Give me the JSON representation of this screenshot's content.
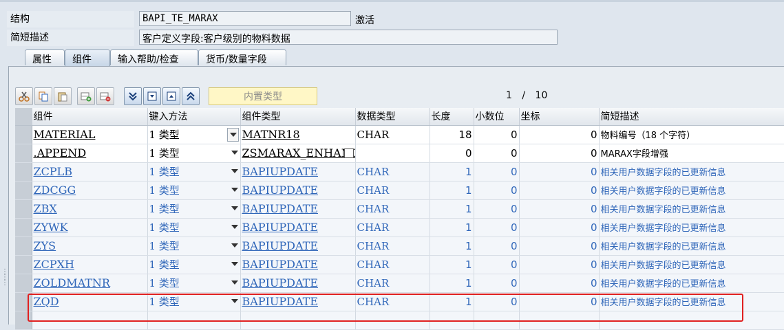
{
  "header": {
    "structure_label": "结构",
    "structure_value": "BAPI_TE_MARAX",
    "status": "激活",
    "desc_label": "简短描述",
    "desc_value": "客户定义字段:客户级别的物料数据"
  },
  "tabs": [
    {
      "label": "属性"
    },
    {
      "label": "组件"
    },
    {
      "label": "输入帮助/检查"
    },
    {
      "label": "货币/数量字段"
    }
  ],
  "toolbar": {
    "builtin_type_label": "内置类型",
    "page_current": "1",
    "page_sep": "/",
    "page_total": "10"
  },
  "columns": [
    "组件",
    "键入方法",
    "组件类型",
    "数据类型",
    "长度",
    "小数位",
    "坐标",
    "简短描述"
  ],
  "rows": [
    {
      "component": "MATERIAL",
      "method": "1 类型",
      "type": "MATNR18",
      "datatype": "CHAR",
      "length": "18",
      "decimals": "0",
      "coord": "0",
      "desc": "物料编号（18 个字符）"
    },
    {
      "component": ".APPEND",
      "method": "1 类型",
      "type": "ZSMARAX_ENHANCE",
      "datatype": "",
      "length": "0",
      "decimals": "0",
      "coord": "0",
      "desc": "MARAX字段增强"
    },
    {
      "component": "ZCPLB",
      "method": "1 类型",
      "type": "BAPIUPDATE",
      "datatype": "CHAR",
      "length": "1",
      "decimals": "0",
      "coord": "0",
      "desc": "相关用户数据字段的已更新信息"
    },
    {
      "component": "ZDCGG",
      "method": "1 类型",
      "type": "BAPIUPDATE",
      "datatype": "CHAR",
      "length": "1",
      "decimals": "0",
      "coord": "0",
      "desc": "相关用户数据字段的已更新信息"
    },
    {
      "component": "ZBX",
      "method": "1 类型",
      "type": "BAPIUPDATE",
      "datatype": "CHAR",
      "length": "1",
      "decimals": "0",
      "coord": "0",
      "desc": "相关用户数据字段的已更新信息"
    },
    {
      "component": "ZYWK",
      "method": "1 类型",
      "type": "BAPIUPDATE",
      "datatype": "CHAR",
      "length": "1",
      "decimals": "0",
      "coord": "0",
      "desc": "相关用户数据字段的已更新信息"
    },
    {
      "component": "ZYS",
      "method": "1 类型",
      "type": "BAPIUPDATE",
      "datatype": "CHAR",
      "length": "1",
      "decimals": "0",
      "coord": "0",
      "desc": "相关用户数据字段的已更新信息"
    },
    {
      "component": "ZCPXH",
      "method": "1 类型",
      "type": "BAPIUPDATE",
      "datatype": "CHAR",
      "length": "1",
      "decimals": "0",
      "coord": "0",
      "desc": "相关用户数据字段的已更新信息"
    },
    {
      "component": "ZOLDMATNR",
      "method": "1 类型",
      "type": "BAPIUPDATE",
      "datatype": "CHAR",
      "length": "1",
      "decimals": "0",
      "coord": "0",
      "desc": "相关用户数据字段的已更新信息"
    },
    {
      "component": "ZQD",
      "method": "1 类型",
      "type": "BAPIUPDATE",
      "datatype": "CHAR",
      "length": "1",
      "decimals": "0",
      "coord": "0",
      "desc": "相关用户数据字段的已更新信息"
    }
  ],
  "colors": {
    "link_blue": "#2f66b9",
    "highlight_red": "#e02020"
  }
}
